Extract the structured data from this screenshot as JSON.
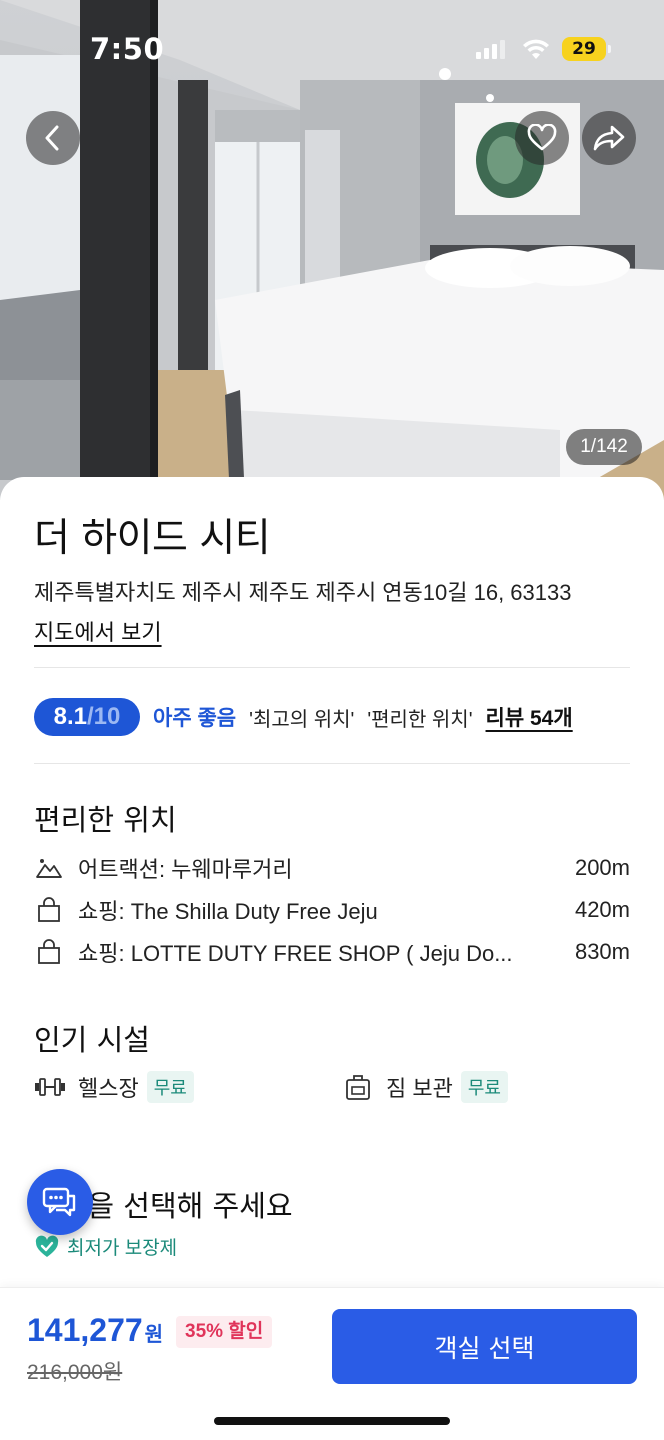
{
  "status_bar": {
    "time": "7:50",
    "battery": "29"
  },
  "hero": {
    "photo_counter": "1/142"
  },
  "hotel": {
    "name": "더 하이드 시티",
    "address": "제주특별자치도 제주시 제주도 제주시 연동10길 16, 63133",
    "map_link": "지도에서 보기"
  },
  "rating": {
    "score": "8.1",
    "out_of": "/10",
    "label": "아주 좋음",
    "tags": [
      "'최고의 위치'",
      "'편리한 위치'"
    ],
    "reviews": "리뷰 54개"
  },
  "location_section": {
    "title": "편리한 위치",
    "items": [
      {
        "icon": "attraction-icon",
        "name": "어트랙션: 누웨마루거리",
        "distance": "200m"
      },
      {
        "icon": "shopping-bag-icon",
        "name": "쇼핑: The Shilla Duty Free Jeju",
        "distance": "420m"
      },
      {
        "icon": "shopping-bag-icon",
        "name": "쇼핑: LOTTE DUTY FREE SHOP ( Jeju Do...",
        "distance": "830m"
      }
    ]
  },
  "facilities_section": {
    "title": "인기 시설",
    "items": [
      {
        "icon": "dumbbell-icon",
        "label": "헬스장",
        "tag": "무료"
      },
      {
        "icon": "luggage-icon",
        "label": "짐 보관",
        "tag": "무료"
      }
    ]
  },
  "room_section": {
    "title": "객실을 선택해 주세요",
    "guarantee": "최저가 보장제"
  },
  "bottom_bar": {
    "price": "141,277",
    "price_unit": "원",
    "discount": "35% 할인",
    "original_price": "216,000원",
    "button": "객실 선택"
  },
  "colors": {
    "accent": "#1e56d6",
    "button": "#2a5ce6",
    "discount": "#e0345a",
    "free_tag": "#1b8a7a"
  }
}
